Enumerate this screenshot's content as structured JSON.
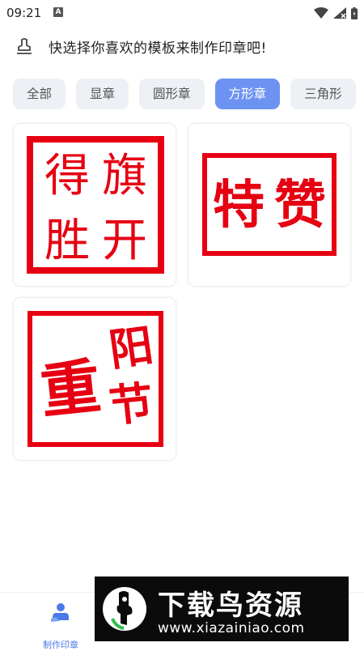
{
  "status_bar": {
    "time": "09:21",
    "notification_badge": "A"
  },
  "header": {
    "title": "快选择你喜欢的模板来制作印章吧!",
    "icon": "stamp-icon"
  },
  "tabs": [
    {
      "label": "全部",
      "active": false
    },
    {
      "label": "显章",
      "active": false
    },
    {
      "label": "圆形章",
      "active": false
    },
    {
      "label": "方形章",
      "active": true
    },
    {
      "label": "三角形",
      "active": false
    }
  ],
  "templates": [
    {
      "chars": [
        "得",
        "旗",
        "胜",
        "开"
      ],
      "color": "#e60012"
    },
    {
      "chars": [
        "特",
        "赞"
      ],
      "color": "#e60012"
    },
    {
      "chars": [
        "重",
        "阳",
        "节"
      ],
      "color": "#e60012"
    }
  ],
  "bottom_nav": {
    "make_label": "制作印章"
  },
  "watermark": {
    "name": "下载鸟资源",
    "url": "www.xiazainiao.com"
  },
  "colors": {
    "accent": "#6d93f2",
    "stamp_red": "#e60012",
    "tab_bg": "#edf0f4"
  }
}
